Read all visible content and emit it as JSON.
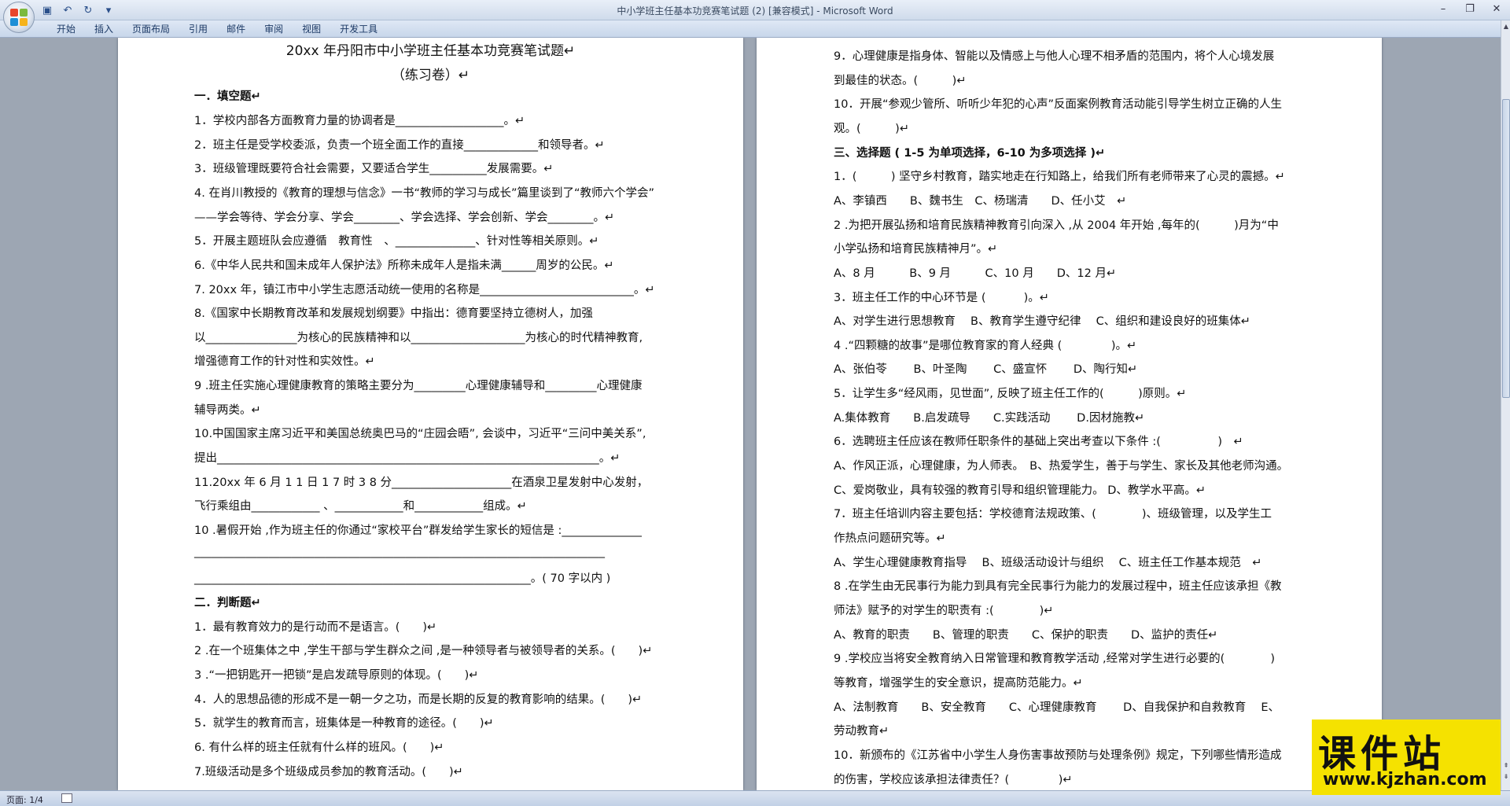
{
  "window": {
    "title": "中小学班主任基本功竞赛笔试题 (2) [兼容模式] - Microsoft Word"
  },
  "ribbon": {
    "tabs": [
      "开始",
      "插入",
      "页面布局",
      "引用",
      "邮件",
      "审阅",
      "视图",
      "开发工具"
    ]
  },
  "status": {
    "page": "页面: 1/4"
  },
  "watermark": {
    "title": "课件站",
    "url": "www.kjzhan.com"
  },
  "colors": {
    "titlebar": "#dfe8f5",
    "page": "#ffffff",
    "workspace": "#9da6b3",
    "watermark": "#f5e200"
  },
  "left_page": [
    "20xx 年丹阳市中小学班主任基本功竞赛笔试题↵",
    "（练习卷）↵",
    "一．填空题↵",
    "1．学校内部各方面教育力量的协调者是___________________。↵",
    "2．班主任是受学校委派，负责一个班全面工作的直接_____________和领导者。↵",
    "3．班级管理既要符合社会需要，又要适合学生__________发展需要。↵",
    "4. 在肖川教授的《教育的理想与信念》一书“教师的学习与成长”篇里谈到了“教师六个学会”",
    "——学会等待、学会分享、学会________、学会选择、学会创新、学会________。↵",
    "5．开展主题班队会应遵循　教育性　、______________、针对性等相关原则。↵",
    "6.《中华人民共和国未成年人保护法》所称未成年人是指未满______周岁的公民。↵",
    "7. 20xx 年，镇江市中小学生志愿活动统一使用的名称是___________________________。↵",
    "8.《国家中长期教育改革和发展规划纲要》中指出：德育要坚持立德树人，加强",
    "以________________为核心的民族精神和以____________________为核心的时代精神教育,",
    "增强德育工作的针对性和实效性。↵",
    "9 .班主任实施心理健康教育的策略主要分为_________心理健康辅导和_________心理健康",
    "辅导两类。↵",
    " 10.中国国家主席习近平和美国总统奥巴马的“庄园会晤”, 会谈中，习近平“三问中美关系”,",
    "提出___________________________________________________________________。↵",
    "11.20xx 年 6 月 1 1 日 1 7 时 3 8 分_____________________在酒泉卫星发射中心发射，",
    "飞行乘组由____________ 、____________和____________组成。↵",
    "10 .暑假开始 ,作为班主任的你通过“家校平台”群发给学生家长的短信是 :______________",
    "________________________________________________________________________",
    "___________________________________________________________。( 70 字以内 ) ",
    "二．判断题↵",
    "1．最有教育效力的是行动而不是语言。(　　)↵",
    "2 .在一个班集体之中 ,学生干部与学生群众之间 ,是一种领导者与被领导者的关系。(　　)↵",
    "3 .“一把钥匙开一把锁”是启发疏导原则的体现。(　　)↵",
    "4．人的思想品德的形成不是一朝一夕之功，而是长期的反复的教育影响的结果。(　　)↵",
    "5．就学生的教育而言，班集体是一种教育的途径。(　　)↵",
    "6. 有什么样的班主任就有什么样的班风。(　　)↵",
    "7.班级活动是多个班级成员参加的教育活动。(　　)↵"
  ],
  "right_page": [
    "9．心理健康是指身体、智能以及情感上与他人心理不相矛盾的范围内，将个人心境发展",
    "到最佳的状态。(　　　)↵",
    "10．开展“参观少管所、听听少年犯的心声”反面案例教育活动能引导学生树立正确的人生",
    "观。(　　　)↵",
    "三、选择题 ( 1-5 为单项选择，6-10 为多项选择 )↵",
    "1．(　　　) 坚守乡村教育，踏实地走在行知路上，给我们所有老师带来了心灵的震撼。↵",
    "A、李镇西　　B、魏书生　C、杨瑞清　　D、任小艾　↵",
    "2 .为把开展弘扬和培育民族精神教育引向深入 ,从 2004 年开始 ,每年的(　　　)月为“中",
    "小学弘扬和培育民族精神月”。↵",
    "A、8 月　　　B、9 月　　　C、10 月　　D、12 月↵",
    "3．班主任工作的中心环节是 (　　　 )。↵",
    "A、对学生进行思想教育　 B、教育学生遵守纪律　 C、组织和建设良好的班集体↵",
    "4 .“四颗糖的故事”是哪位教育家的育人经典 (　　　　 )。↵",
    "A、张伯苓　　 B、叶圣陶　　 C、盛宣怀　　 D、陶行知↵",
    "5．让学生多“经风雨，见世面”, 反映了班主任工作的(　　　)原则。↵",
    "A.集体教育　　B.启发疏导　　C.实践活动　　 D.因材施教↵",
    "6．选聘班主任应该在教师任职条件的基础上突出考查以下条件 :(　　　　　)　↵",
    "A、作风正派，心理健康，为人师表。　B、热爱学生，善于与学生、家长及其他老师沟通。",
    "C、爱岗敬业，具有较强的教育引导和组织管理能力。 D、教学水平高。↵",
    "7．班主任培训内容主要包括：学校德育法规政策、(　　　　)、班级管理，以及学生工",
    "作热点问题研究等。↵",
    "A、学生心理健康教育指导　 B、班级活动设计与组织　 C、班主任工作基本规范　↵",
    "8 .在学生由无民事行为能力到具有完全民事行为能力的发展过程中，班主任应该承担《教",
    "师法》赋予的对学生的职责有 :(　　　　)↵",
    "A、教育的职责　　B、管理的职责　　C、保护的职责　　D、监护的责任↵",
    "9 .学校应当将安全教育纳入日常管理和教育教学活动 ,经常对学生进行必要的(　　　　)",
    "等教育，增强学生的安全意识，提高防范能力。↵",
    "A、法制教育　　B、安全教育　　C、心理健康教育　　 D、自我保护和自救教育　 E、",
    "劳动教育↵",
    "10．新颁布的《江苏省中小学生人身伤害事故预防与处理条例》规定，下列哪些情形造成",
    "的伤害，学校应该承担法律责任？(　　　　 )↵"
  ]
}
